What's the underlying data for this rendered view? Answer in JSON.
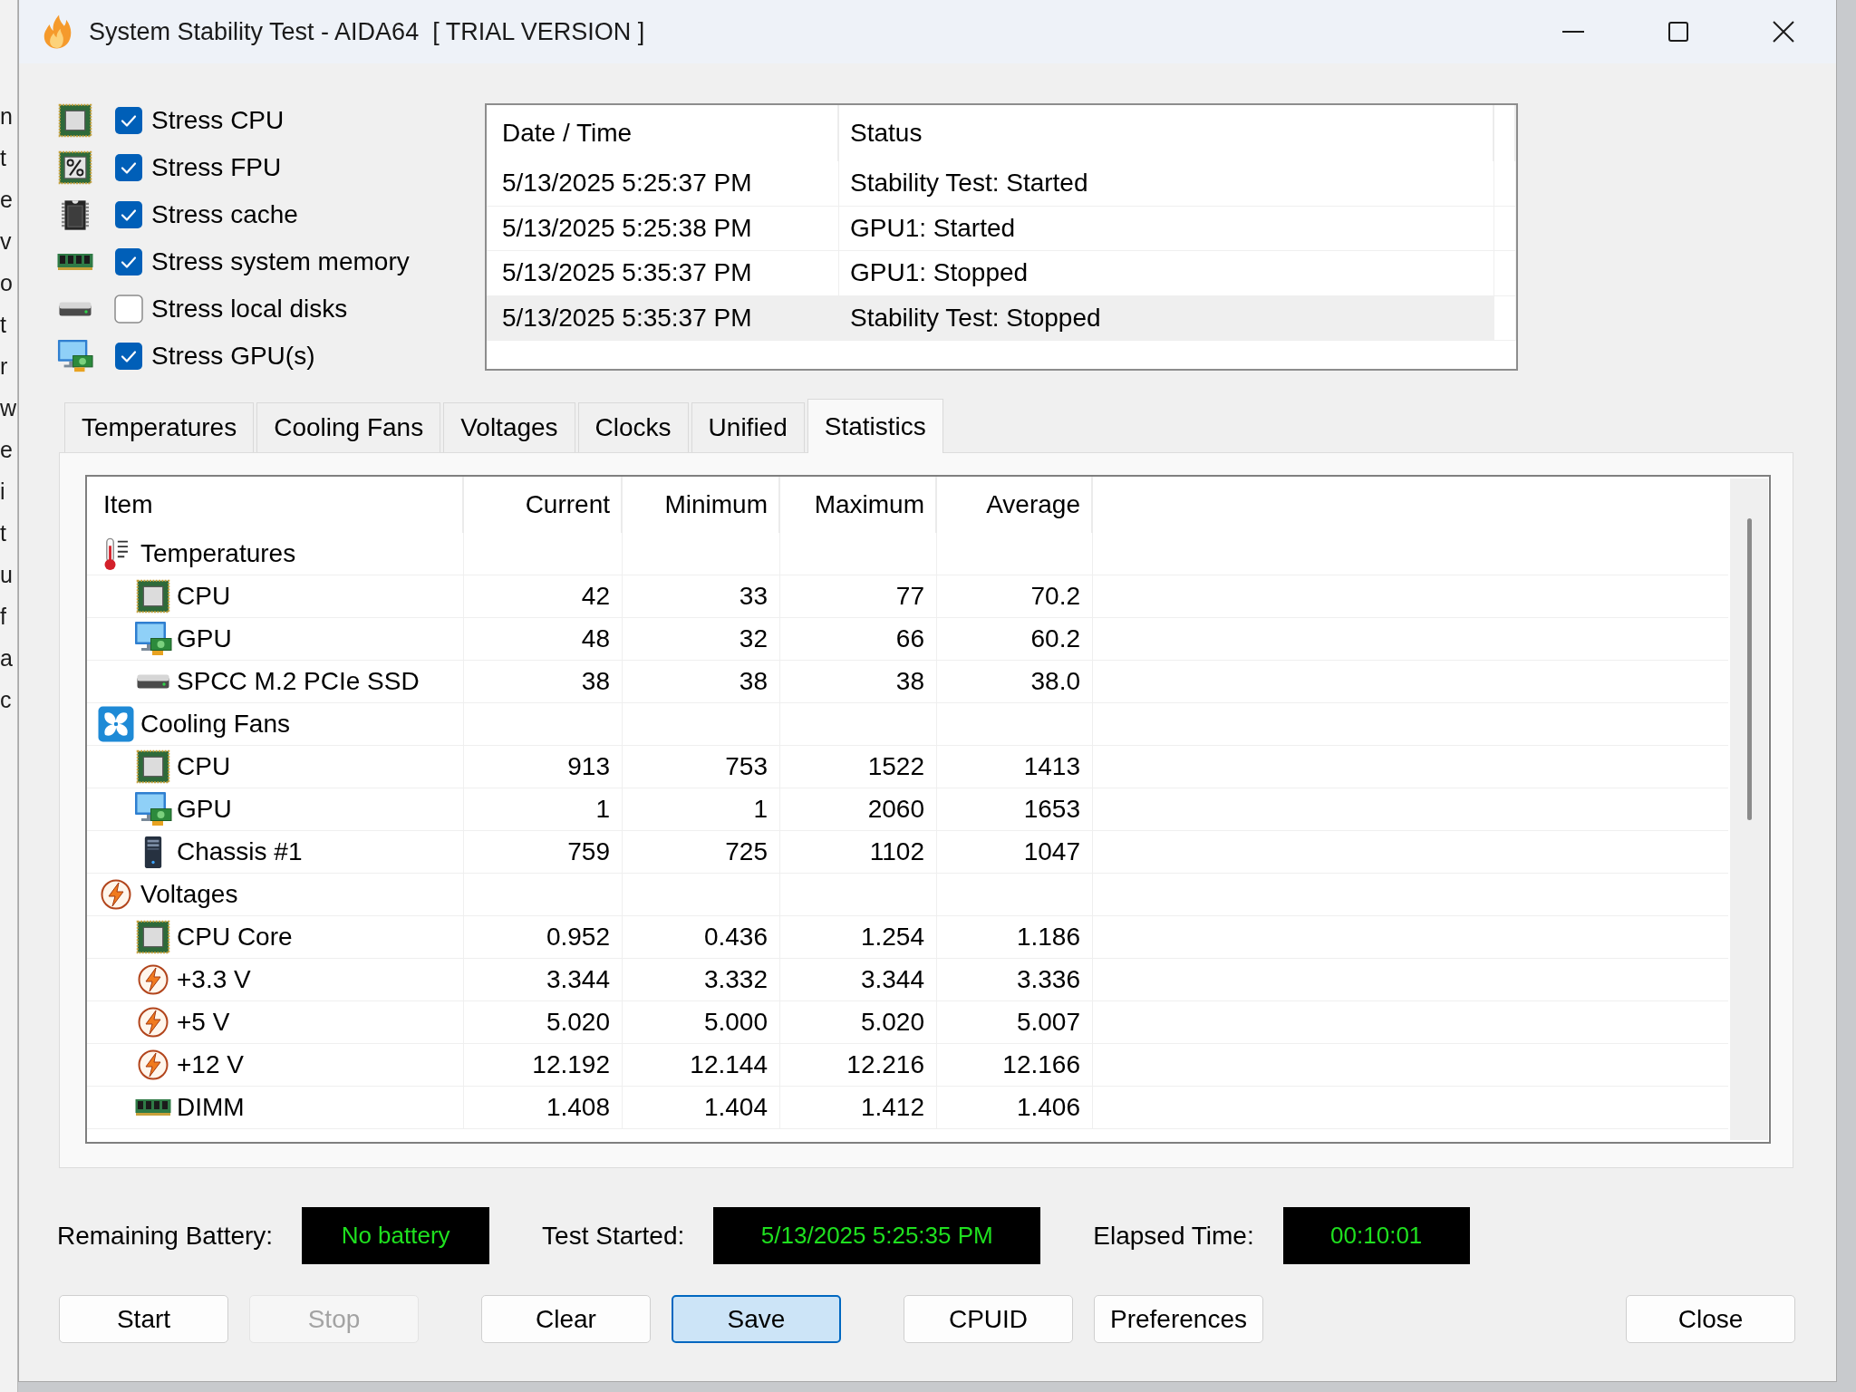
{
  "background_window": {
    "fragments": [
      "n",
      "t",
      "e",
      "v",
      "o",
      "t",
      "r",
      "w",
      "e",
      "i",
      "t",
      "u",
      "f",
      "a",
      "c"
    ]
  },
  "window": {
    "title": "System Stability Test - AIDA64  [ TRIAL VERSION ]"
  },
  "stress_options": [
    {
      "kind": "cpu",
      "label": "Stress CPU",
      "checked": true
    },
    {
      "kind": "fpu",
      "label": "Stress FPU",
      "checked": true
    },
    {
      "kind": "cache",
      "label": "Stress cache",
      "checked": true
    },
    {
      "kind": "memory",
      "label": "Stress system memory",
      "checked": true
    },
    {
      "kind": "disk",
      "label": "Stress local disks",
      "checked": false
    },
    {
      "kind": "gpu",
      "label": "Stress GPU(s)",
      "checked": true
    }
  ],
  "log": {
    "columns": [
      "Date / Time",
      "Status"
    ],
    "rows": [
      {
        "time": "5/13/2025 5:25:37 PM",
        "status": "Stability Test: Started",
        "selected": false
      },
      {
        "time": "5/13/2025 5:25:38 PM",
        "status": "GPU1: Started",
        "selected": false
      },
      {
        "time": "5/13/2025 5:35:37 PM",
        "status": "GPU1: Stopped",
        "selected": false
      },
      {
        "time": "5/13/2025 5:35:37 PM",
        "status": "Stability Test: Stopped",
        "selected": true
      }
    ]
  },
  "tabs": [
    {
      "label": "Temperatures",
      "selected": false
    },
    {
      "label": "Cooling Fans",
      "selected": false
    },
    {
      "label": "Voltages",
      "selected": false
    },
    {
      "label": "Clocks",
      "selected": false
    },
    {
      "label": "Unified",
      "selected": false
    },
    {
      "label": "Statistics",
      "selected": true
    }
  ],
  "statistics": {
    "columns": [
      "Item",
      "Current",
      "Minimum",
      "Maximum",
      "Average"
    ],
    "groups": [
      {
        "kind": "temperature",
        "label": "Temperatures",
        "children": [
          {
            "kind": "cpu",
            "label": "CPU",
            "values": [
              "42",
              "33",
              "77",
              "70.2"
            ]
          },
          {
            "kind": "gpu",
            "label": "GPU",
            "values": [
              "48",
              "32",
              "66",
              "60.2"
            ]
          },
          {
            "kind": "disk",
            "label": "SPCC M.2 PCIe SSD",
            "values": [
              "38",
              "38",
              "38",
              "38.0"
            ]
          }
        ]
      },
      {
        "kind": "fan",
        "label": "Cooling Fans",
        "children": [
          {
            "kind": "cpu",
            "label": "CPU",
            "values": [
              "913",
              "753",
              "1522",
              "1413"
            ]
          },
          {
            "kind": "gpu",
            "label": "GPU",
            "values": [
              "1",
              "1",
              "2060",
              "1653"
            ]
          },
          {
            "kind": "chassis",
            "label": "Chassis #1",
            "values": [
              "759",
              "725",
              "1102",
              "1047"
            ]
          }
        ]
      },
      {
        "kind": "voltage",
        "label": "Voltages",
        "children": [
          {
            "kind": "cpu",
            "label": "CPU Core",
            "values": [
              "0.952",
              "0.436",
              "1.254",
              "1.186"
            ]
          },
          {
            "kind": "voltage",
            "label": "+3.3 V",
            "values": [
              "3.344",
              "3.332",
              "3.344",
              "3.336"
            ]
          },
          {
            "kind": "voltage",
            "label": "+5 V",
            "values": [
              "5.020",
              "5.000",
              "5.020",
              "5.007"
            ]
          },
          {
            "kind": "voltage",
            "label": "+12 V",
            "values": [
              "12.192",
              "12.144",
              "12.216",
              "12.166"
            ]
          },
          {
            "kind": "memory",
            "label": "DIMM",
            "values": [
              "1.408",
              "1.404",
              "1.412",
              "1.406"
            ]
          }
        ]
      }
    ]
  },
  "status": [
    {
      "label": "Remaining Battery:",
      "value": "No battery"
    },
    {
      "label": "Test Started:",
      "value": "5/13/2025 5:25:35 PM"
    },
    {
      "label": "Elapsed Time:",
      "value": "00:10:01"
    }
  ],
  "buttons": [
    {
      "label": "Start",
      "disabled": false,
      "focused": false
    },
    {
      "label": "Stop",
      "disabled": true,
      "focused": false
    },
    {
      "label": "Clear",
      "disabled": false,
      "focused": false
    },
    {
      "label": "Save",
      "disabled": false,
      "focused": true
    },
    {
      "label": "CPUID",
      "disabled": false,
      "focused": false
    },
    {
      "label": "Preferences",
      "disabled": false,
      "focused": false
    },
    {
      "label": "Close",
      "disabled": false,
      "focused": false
    }
  ]
}
